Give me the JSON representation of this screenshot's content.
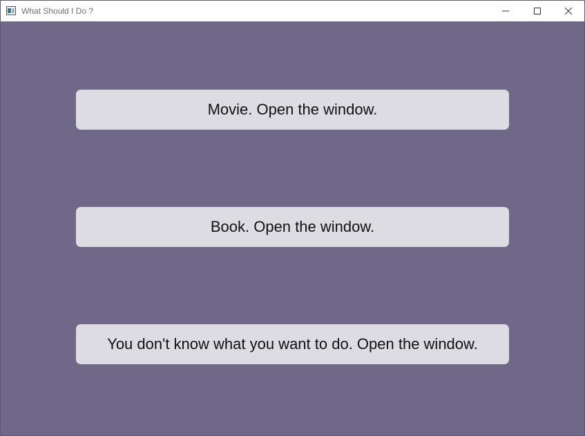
{
  "window": {
    "title": "What Should I Do ?",
    "icons": {
      "app": "app-window-icon",
      "minimize": "minimize-icon",
      "maximize": "maximize-icon",
      "close": "close-icon"
    }
  },
  "colors": {
    "background": "#6f6889",
    "button": "#dddce3",
    "button_text": "#111111",
    "titlebar": "#ffffff"
  },
  "choices": [
    {
      "label": "Movie. Open the window."
    },
    {
      "label": "Book. Open the window."
    },
    {
      "label": "You don't know what you want to do. Open the window."
    }
  ]
}
